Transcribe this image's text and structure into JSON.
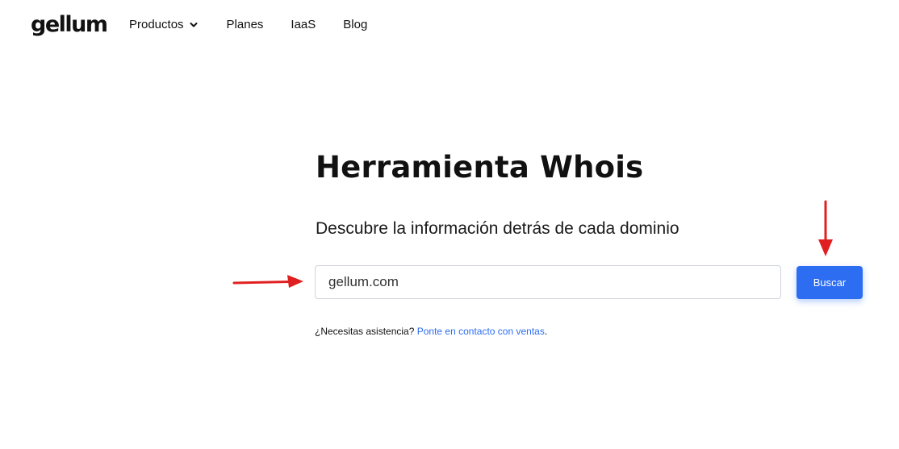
{
  "header": {
    "logo_text": "gellum",
    "nav": {
      "productos": "Productos",
      "planes": "Planes",
      "iaas": "IaaS",
      "blog": "Blog"
    },
    "dropdown_icon": "chevron-down-icon"
  },
  "main": {
    "title": "Herramienta Whois",
    "subtitle": "Descubre la información detrás de cada dominio",
    "search": {
      "value": "gellum.com",
      "button_label": "Buscar"
    },
    "help": {
      "prefix": "¿Necesitas asistencia?",
      "link_text": "Ponte en contacto con ventas",
      "suffix": "."
    }
  },
  "annotations": {
    "arrow_color": "#e02020",
    "icons": [
      "arrow-right-icon",
      "arrow-down-icon"
    ]
  },
  "colors": {
    "accent": "#2c6df2",
    "text": "#111111"
  }
}
